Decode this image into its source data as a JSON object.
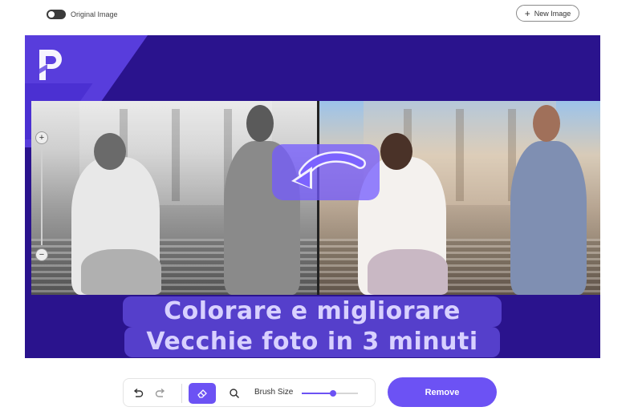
{
  "header": {
    "toggle_label": "Original Image",
    "new_image_label": "New Image"
  },
  "canvas": {
    "caption_line1": "Colorare e migliorare",
    "caption_line2": "Vecchie foto in 3 minuti",
    "zoom_in_symbol": "+",
    "zoom_out_symbol": "−"
  },
  "toolbar": {
    "undo_icon": "undo-icon",
    "redo_icon": "redo-icon",
    "eraser_icon": "eraser-icon",
    "zoom_icon": "magnifier-icon",
    "brush_size_label": "Brush Size",
    "brush_size_fraction": 0.55
  },
  "actions": {
    "remove_label": "Remove"
  },
  "colors": {
    "accent": "#6c52f4",
    "canvas_bg": "#2a138d"
  }
}
